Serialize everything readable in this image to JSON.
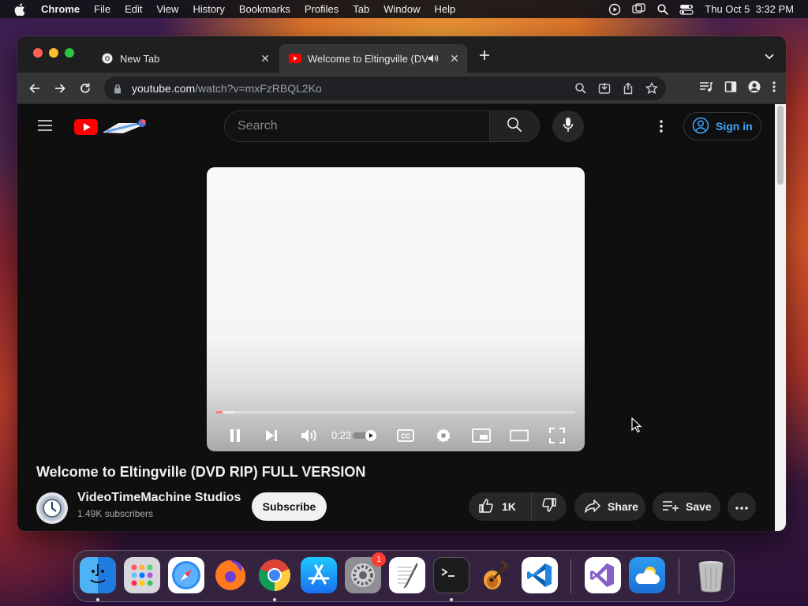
{
  "menubar": {
    "app": "Chrome",
    "items": [
      "File",
      "Edit",
      "View",
      "History",
      "Bookmarks",
      "Profiles",
      "Tab",
      "Window",
      "Help"
    ],
    "clock": "Thu Oct 5  3:32 PM"
  },
  "tabs": [
    {
      "title": "New Tab",
      "icon": "chrome-icon",
      "active": false
    },
    {
      "title": "Welcome to Eltingville (DV",
      "icon": "youtube-icon",
      "active": true
    }
  ],
  "address_bar": {
    "host": "youtube.com",
    "path": "/watch?v=mxFzRBQL2Ko"
  },
  "youtube": {
    "search_placeholder": "Search",
    "signin_label": "Sign in",
    "player": {
      "time": "0:23",
      "progress": 0.018,
      "state": "playing"
    },
    "video_title": "Welcome to Eltingville (DVD RIP) FULL VERSION",
    "channel_name": "VideoTimeMachine Studios",
    "subscribers": "1.49K subscribers",
    "subscribe_label": "Subscribe",
    "likes": "1K",
    "share_label": "Share",
    "save_label": "Save"
  },
  "dock": {
    "apps": [
      "finder-icon",
      "launchpad-icon",
      "safari-icon",
      "firefox-icon",
      "chrome-icon",
      "app-store-icon",
      "system-settings-icon",
      "textedit-icon",
      "terminal-icon",
      "garageband-icon",
      "vscode-icon",
      "visual-studio-icon",
      "weather-icon",
      "trash-icon"
    ],
    "settings_badge": "1"
  },
  "colors": {
    "accent_red": "#ff0000",
    "link_blue": "#3ea6ff",
    "page_bg": "#0f0f0f"
  }
}
